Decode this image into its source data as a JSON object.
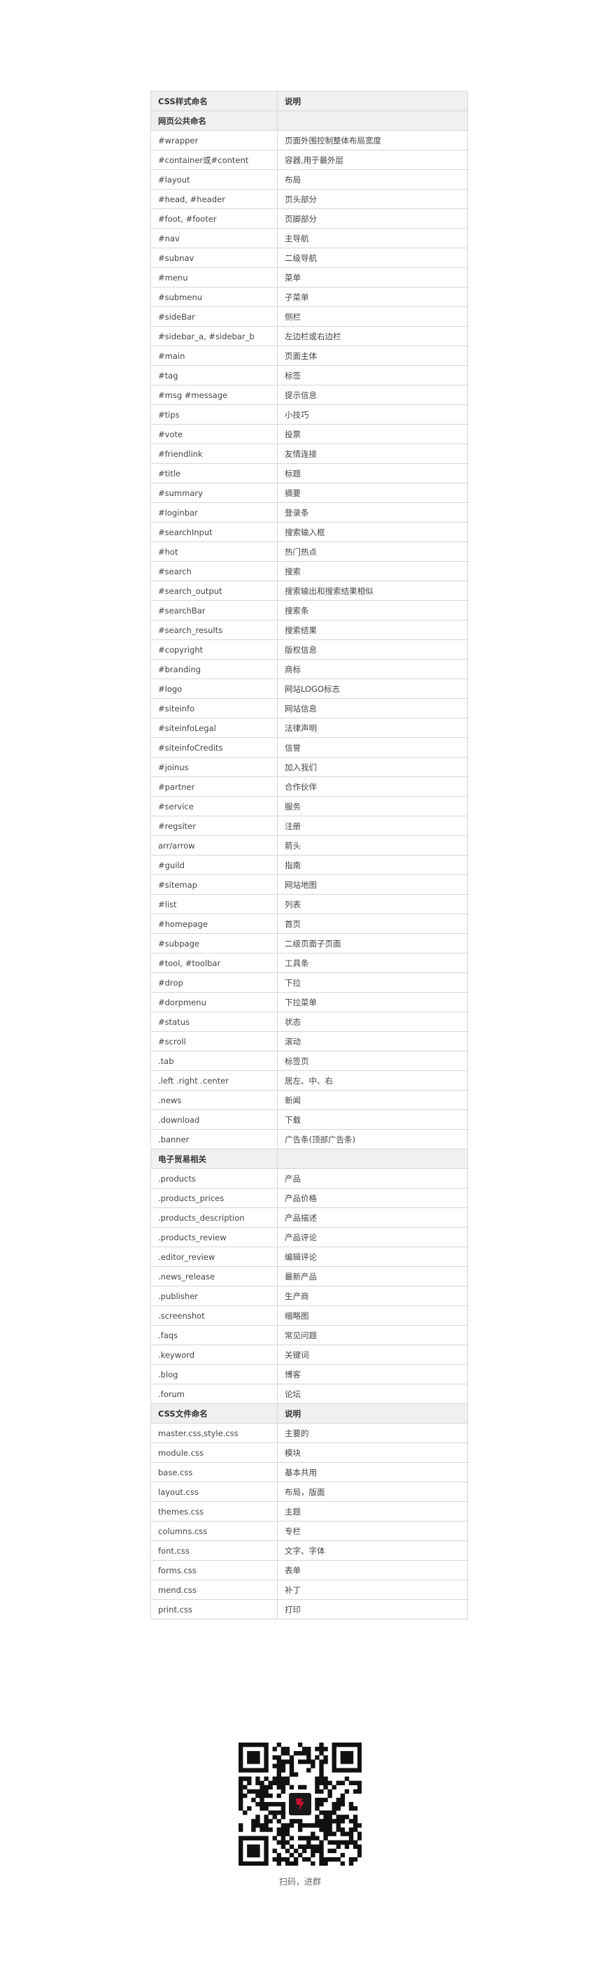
{
  "table": {
    "rows": [
      {
        "kind": "header",
        "cells": [
          "CSS样式命名",
          "说明"
        ]
      },
      {
        "kind": "section",
        "cells": [
          "网页公共命名",
          ""
        ]
      },
      {
        "kind": "row",
        "cells": [
          "#wrapper",
          "页面外围控制整体布局宽度"
        ]
      },
      {
        "kind": "row",
        "cells": [
          "#container或#content",
          "容器,用于最外层"
        ]
      },
      {
        "kind": "row",
        "cells": [
          "#layout",
          "布局"
        ]
      },
      {
        "kind": "row",
        "cells": [
          "#head, #header",
          "页头部分"
        ]
      },
      {
        "kind": "row",
        "cells": [
          "#foot, #footer",
          "页脚部分"
        ]
      },
      {
        "kind": "row",
        "cells": [
          "#nav",
          "主导航"
        ]
      },
      {
        "kind": "row",
        "cells": [
          "#subnav",
          "二级导航"
        ]
      },
      {
        "kind": "row",
        "cells": [
          "#menu",
          "菜单"
        ]
      },
      {
        "kind": "row",
        "cells": [
          "#submenu",
          "子菜单"
        ]
      },
      {
        "kind": "row",
        "cells": [
          "#sideBar",
          "侧栏"
        ]
      },
      {
        "kind": "row",
        "cells": [
          "#sidebar_a, #sidebar_b",
          "左边栏或右边栏"
        ]
      },
      {
        "kind": "row",
        "cells": [
          "#main",
          "页面主体"
        ]
      },
      {
        "kind": "row",
        "cells": [
          "#tag",
          "标签"
        ]
      },
      {
        "kind": "row",
        "cells": [
          "#msg #message",
          "提示信息"
        ]
      },
      {
        "kind": "row",
        "cells": [
          "#tips",
          "小技巧"
        ]
      },
      {
        "kind": "row",
        "cells": [
          "#vote",
          "投票"
        ]
      },
      {
        "kind": "row",
        "cells": [
          "#friendlink",
          "友情连接"
        ]
      },
      {
        "kind": "row",
        "cells": [
          "#title",
          "标题"
        ]
      },
      {
        "kind": "row",
        "cells": [
          "#summary",
          "摘要"
        ]
      },
      {
        "kind": "row",
        "cells": [
          "#loginbar",
          "登录条"
        ]
      },
      {
        "kind": "row",
        "cells": [
          "#searchInput",
          "搜索输入框"
        ]
      },
      {
        "kind": "row",
        "cells": [
          "#hot",
          "热门热点"
        ]
      },
      {
        "kind": "row",
        "cells": [
          "#search",
          "搜索"
        ]
      },
      {
        "kind": "row",
        "cells": [
          "#search_output",
          "搜索输出和搜索结果相似"
        ]
      },
      {
        "kind": "row",
        "cells": [
          "#searchBar",
          "搜索条"
        ]
      },
      {
        "kind": "row",
        "cells": [
          "#search_results",
          "搜索结果"
        ]
      },
      {
        "kind": "row",
        "cells": [
          "#copyright",
          "版权信息"
        ]
      },
      {
        "kind": "row",
        "cells": [
          "#branding",
          "商标"
        ]
      },
      {
        "kind": "row",
        "cells": [
          "#logo",
          "网站LOGO标志"
        ]
      },
      {
        "kind": "row",
        "cells": [
          "#siteinfo",
          "网站信息"
        ]
      },
      {
        "kind": "row",
        "cells": [
          "#siteinfoLegal",
          "法律声明"
        ]
      },
      {
        "kind": "row",
        "cells": [
          "#siteinfoCredits",
          "信誉"
        ]
      },
      {
        "kind": "row",
        "cells": [
          "#joinus",
          "加入我们"
        ]
      },
      {
        "kind": "row",
        "cells": [
          "#partner",
          "合作伙伴"
        ]
      },
      {
        "kind": "row",
        "cells": [
          "#service",
          "服务"
        ]
      },
      {
        "kind": "row",
        "cells": [
          "#regsiter",
          "注册"
        ]
      },
      {
        "kind": "row",
        "cells": [
          "arr/arrow",
          "箭头"
        ]
      },
      {
        "kind": "row",
        "cells": [
          "#guild",
          "指南"
        ]
      },
      {
        "kind": "row",
        "cells": [
          "#sitemap",
          "网站地图"
        ]
      },
      {
        "kind": "row",
        "cells": [
          "#list",
          "列表"
        ]
      },
      {
        "kind": "row",
        "cells": [
          "#homepage",
          "首页"
        ]
      },
      {
        "kind": "row",
        "cells": [
          "#subpage",
          "二级页面子页面"
        ]
      },
      {
        "kind": "row",
        "cells": [
          "#tool, #toolbar",
          "工具条"
        ]
      },
      {
        "kind": "row",
        "cells": [
          "#drop",
          "下拉"
        ]
      },
      {
        "kind": "row",
        "cells": [
          "#dorpmenu",
          "下拉菜单"
        ]
      },
      {
        "kind": "row",
        "cells": [
          "#status",
          "状态"
        ]
      },
      {
        "kind": "row",
        "cells": [
          "#scroll",
          "滚动"
        ]
      },
      {
        "kind": "row",
        "cells": [
          ".tab",
          "标签页"
        ]
      },
      {
        "kind": "row",
        "cells": [
          ".left .right .center",
          "居左、中、右"
        ]
      },
      {
        "kind": "row",
        "cells": [
          ".news",
          "新闻"
        ]
      },
      {
        "kind": "row",
        "cells": [
          ".download",
          "下载"
        ]
      },
      {
        "kind": "row",
        "cells": [
          ".banner",
          "广告条(顶部广告条)"
        ]
      },
      {
        "kind": "section",
        "cells": [
          "电子贸易相关",
          ""
        ]
      },
      {
        "kind": "row",
        "cells": [
          ".products",
          "产品"
        ]
      },
      {
        "kind": "row",
        "cells": [
          ".products_prices",
          "产品价格"
        ]
      },
      {
        "kind": "row",
        "cells": [
          ".products_description",
          "产品描述"
        ]
      },
      {
        "kind": "row",
        "cells": [
          ".products_review",
          "产品评论"
        ]
      },
      {
        "kind": "row",
        "cells": [
          ".editor_review",
          "编辑评论"
        ]
      },
      {
        "kind": "row",
        "cells": [
          ".news_release",
          "最新产品"
        ]
      },
      {
        "kind": "row",
        "cells": [
          ".publisher",
          "生产商"
        ]
      },
      {
        "kind": "row",
        "cells": [
          ".screenshot",
          "缩略图"
        ]
      },
      {
        "kind": "row",
        "cells": [
          ".faqs",
          "常见问题"
        ]
      },
      {
        "kind": "row",
        "cells": [
          ".keyword",
          "关键词"
        ]
      },
      {
        "kind": "row",
        "cells": [
          ".blog",
          "博客"
        ]
      },
      {
        "kind": "row",
        "cells": [
          ".forum",
          "论坛"
        ]
      },
      {
        "kind": "header",
        "cells": [
          "CSS文件命名",
          "说明"
        ]
      },
      {
        "kind": "row",
        "cells": [
          "master.css,style.css",
          "主要的"
        ]
      },
      {
        "kind": "row",
        "cells": [
          "module.css",
          "模块"
        ]
      },
      {
        "kind": "row",
        "cells": [
          "base.css",
          "基本共用"
        ]
      },
      {
        "kind": "row",
        "cells": [
          "layout.css",
          "布局，版面"
        ]
      },
      {
        "kind": "row",
        "cells": [
          "themes.css",
          "主题"
        ]
      },
      {
        "kind": "row",
        "cells": [
          "columns.css",
          "专栏"
        ]
      },
      {
        "kind": "row",
        "cells": [
          "font.css",
          "文字、字体"
        ]
      },
      {
        "kind": "row",
        "cells": [
          "forms.css",
          "表单"
        ]
      },
      {
        "kind": "row",
        "cells": [
          "mend.css",
          "补丁"
        ]
      },
      {
        "kind": "row",
        "cells": [
          "print.css",
          "打印"
        ]
      }
    ]
  },
  "qr": {
    "icon": "qr-code-icon",
    "caption": "扫码，进群",
    "accent_color": "#c8102e"
  }
}
